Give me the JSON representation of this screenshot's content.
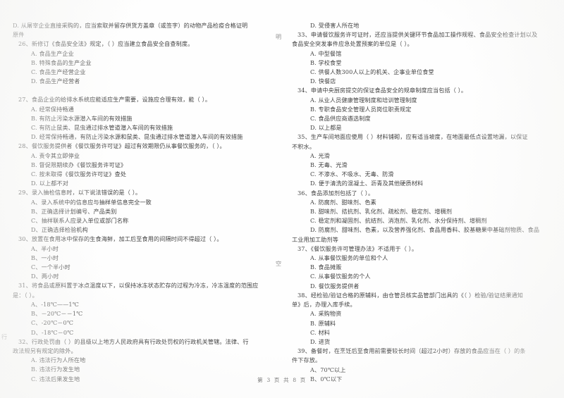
{
  "document": {
    "kind": "scanned-exam-paper",
    "footer": "第 3 页  共 8 页"
  },
  "left_column": {
    "carryover": {
      "line1": "D. 从屠宰企业直接采购的，应当索取并留存供货方盖章（或签字）的动物产品检疫合格证明",
      "line2": "原件"
    },
    "questions": [
      {
        "number": "26",
        "stem": "26、新修订《食品安全法》规定，（     ）应当建立食品安全自查制度。",
        "options": [
          "A. 食品生产企业",
          "B. 特殊食品的生产企业",
          "C. 食品生产经营企业",
          "D. 食品生产经营者"
        ]
      },
      {
        "number": "27",
        "stem": "27、食品企业的给排水系统应能适应生产需要，设施应合理有效，能（     ）。",
        "options": [
          "A. 经常保持畅通",
          "B. 有防止污染水源潜入车间的有效措施",
          "C. 有防止鼠类、昆虫通过排水管道潜入车间的有效措施",
          "D. 经常保持畅通，有防止污染水源和鼠类、昆虫通过排水管道潜入车间的有效措施"
        ]
      },
      {
        "number": "28",
        "stem": "28、餐饮服务提供者《餐饮服务许可证》超过有效期限仍从事餐饮服务的，（     ）。",
        "options": [
          "A. 责令其立即停业",
          "B. 督促限期续办《餐饮服务许可证》",
          "C. 按未取得《餐饮服务许可证》查处",
          "D. 以上都不对"
        ]
      },
      {
        "number": "29",
        "stem": "29、录入抽检信息时，以下说法错误的是（     ）。",
        "options": [
          "A、录入系统中的信息应与抽样单信息完全一致",
          "B、正确选择计划编号、产品类别",
          "C、抽样联系人应录入单位或部门名称",
          "D、正确选择检验机构"
        ]
      },
      {
        "number": "30",
        "stem": "30、放置在食用冰中保存的生食海鲜，加工后至食用的间隔时间不得超过（     ）。",
        "options": [
          "A、半小时",
          "B、一小时",
          "C、一个半小时",
          "D、两小时"
        ]
      },
      {
        "number": "31",
        "stem": "31、将食品或原料置于冰点温度以下，以保持冰冻状态贮存的过程为冷冻，冷冻温度的范围应",
        "stem_cont": "是：（     ）。",
        "options": [
          "A、-18℃——1℃",
          "B、－20℃－－1℃",
          "C、-20℃－0℃",
          "D、-18℃－0℃"
        ]
      },
      {
        "number": "32",
        "stem": "32、行政处罚由（     ）的县级以上地方人民政府具有行政处罚权的行政机关管辖。法律、行",
        "stem_cont": "政法规另有规定的除外。",
        "options": [
          "A. 违法行为人所在地",
          "B. 违法行为发生地",
          "C. 违法后果发生地"
        ]
      }
    ],
    "edge_fragments": [
      "原",
      "行"
    ]
  },
  "right_column": {
    "carryover": {
      "line1": "D. 受侵害人所在地"
    },
    "questions": [
      {
        "number": "33",
        "stem": "33、申请餐饮服务许可证时，还应当提供关键环节食品加工操作规程、食品安全检查计划以及",
        "stem_cont": "食品安全突发事件应急处置预案的单位是（     ）。",
        "options": [
          "A. 中型餐馆",
          "B. 学校食堂",
          "C. 供餐人数300人以上的机关、企事业单位食堂",
          "D. 快餐店"
        ]
      },
      {
        "number": "34",
        "stem": "34、申请中央厨房提交的保证食品安全的规章制度应当包括（     ）。",
        "options": [
          "A. 从业人员健康管理制度和培训管理制度",
          "B. 专职食品安全管理人员岗位职责规定",
          "C. 食品供应商遴选制度",
          "D. 以上都是"
        ]
      },
      {
        "number": "35",
        "stem": "35、生产车间地面应使用（     ）材料铺砌，应有适当坡度，在地面最低点设置地漏，以保证",
        "stem_cont": "不积水。",
        "options": [
          "A. 光滑",
          "B. 无毒、光滑",
          "C. 不渗水、不吸水、无毒、防滑",
          "D. 便于清洗的混凝土、沥青及其他硬质材料"
        ]
      },
      {
        "number": "36",
        "stem": "36、食品添加剂包括了（     ）。",
        "options": [
          "A. 防腐剂、甜味剂、色素",
          "B. 甜味剂、拮抗剂、乳化剂、疏松剂、稳定剂、增稠剂",
          "C. 稳定剂和凝固剂、抗结剂、消泡剂、乳化剂、水分保持剂、增稠剂",
          "D. 防腐剂、甜味剂、色素，以及营养强化剂、食品用香料、胶基糖果中基础剂物质、食品"
        ],
        "option_cont": "工业用加工助剂等"
      },
      {
        "number": "37",
        "stem": "37、《餐饮服务许可管理办法》不适用于（     ）。",
        "options": [
          "A. 从事餐饮服务的单位和个人",
          "B. 食品摊贩",
          "C. 从事餐饮服务的个人",
          "D. 餐饮服务提供者"
        ]
      },
      {
        "number": "38",
        "stem": "38、经检验/验证合格的原辅料，由仓管员核实品管部门出具的《（     ）检验/验证结果通知",
        "stem_cont": "单》后，办理入库手续。",
        "options": [
          "A. 采购物资",
          "B. 原辅料",
          "C. 材料",
          "D. 进货"
        ]
      },
      {
        "number": "39",
        "stem": "39、备餐时，在烹饪后至食用前需要较长时间（超过2小时）存放的食品应当在（     ）的条",
        "stem_cont": "件下存放。",
        "options": [
          "A、70℃以上",
          "B、0℃以下"
        ]
      }
    ],
    "edge_fragments": [
      "明",
      "空"
    ]
  }
}
